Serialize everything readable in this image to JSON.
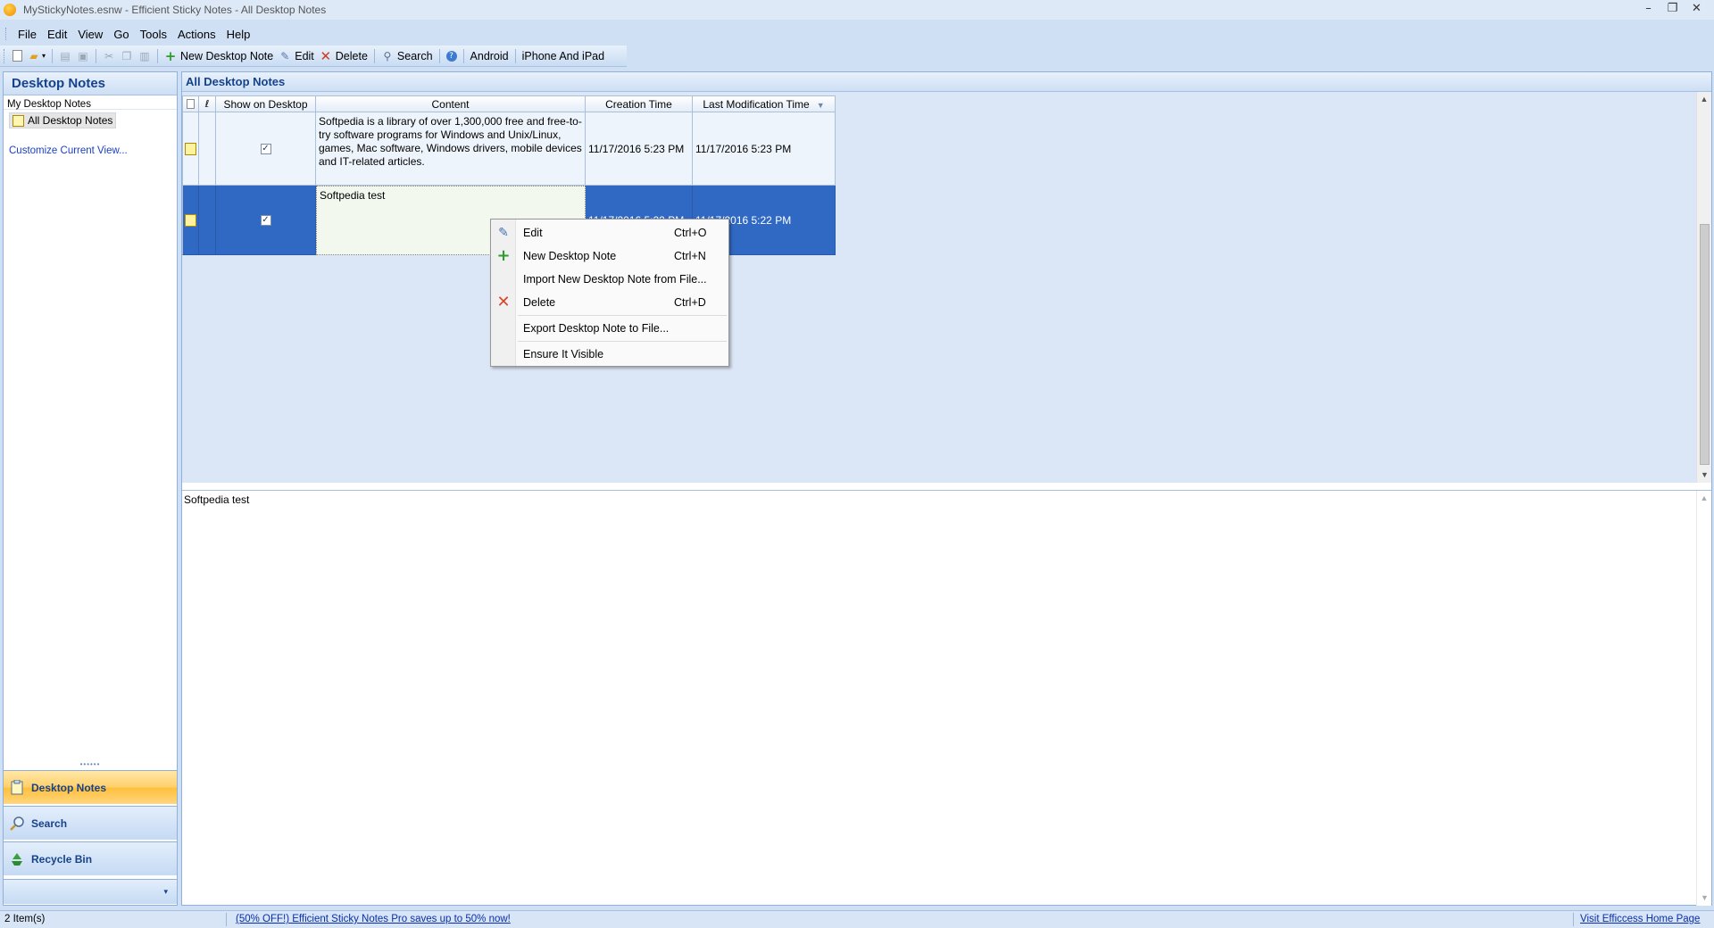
{
  "window": {
    "title": "MyStickyNotes.esnw - Efficient Sticky Notes - All Desktop Notes",
    "controls": [
      "–",
      "❐",
      "✕"
    ]
  },
  "menubar": {
    "items": [
      "File",
      "Edit",
      "View",
      "Go",
      "Tools",
      "Actions",
      "Help"
    ]
  },
  "toolbar": {
    "new_label": "New Desktop Note",
    "edit_label": "Edit",
    "delete_label": "Delete",
    "search_label": "Search",
    "android_label": "Android",
    "iphone_label": "iPhone And iPad"
  },
  "sidebar": {
    "header": "Desktop Notes",
    "section": "My Desktop Notes",
    "tree_item": "All Desktop Notes",
    "customize": "Customize Current View...",
    "nav": [
      {
        "label": "Desktop Notes",
        "icon": "sticky-note-icon",
        "active": true
      },
      {
        "label": "Search",
        "icon": "magnifier-icon",
        "active": false
      },
      {
        "label": "Recycle Bin",
        "icon": "recycle-bin-icon",
        "active": false
      }
    ],
    "footer_glyph": "▾"
  },
  "main": {
    "header": "All Desktop Notes",
    "columns": [
      "",
      "",
      "Show on Desktop",
      "Content",
      "Creation Time",
      "Last Modification Time"
    ],
    "rows": [
      {
        "show_on_desktop": true,
        "content": "Softpedia is a library of over 1,300,000 free and free-to-try software programs for Windows and Unix/Linux, games, Mac software, Windows drivers, mobile devices and IT-related articles.",
        "created": "11/17/2016 5:23 PM",
        "modified": "11/17/2016 5:23 PM",
        "selected": false
      },
      {
        "show_on_desktop": true,
        "content": "Softpedia test",
        "created": "11/17/2016 5:22 PM",
        "modified": "11/17/2016 5:22 PM",
        "selected": true
      }
    ],
    "preview_text": "Softpedia test"
  },
  "context_menu": {
    "items": [
      {
        "label": "Edit",
        "shortcut": "Ctrl+O",
        "icon": "pencil-icon"
      },
      {
        "label": "New Desktop Note",
        "shortcut": "Ctrl+N",
        "icon": "plus-icon"
      },
      {
        "label": "Import New Desktop Note from File...",
        "shortcut": "",
        "icon": ""
      },
      {
        "label": "Delete",
        "shortcut": "Ctrl+D",
        "icon": "delete-x-icon"
      },
      {
        "label": "Export Desktop Note to File...",
        "shortcut": "",
        "icon": ""
      },
      {
        "label": "Ensure It Visible",
        "shortcut": "",
        "icon": ""
      }
    ]
  },
  "statusbar": {
    "item_count": "2 Item(s)",
    "promo": "(50% OFF!) Efficient Sticky Notes Pro saves up to 50% now!",
    "home_link": "Visit Efficcess Home Page"
  },
  "colors": {
    "selection": "#3069c4",
    "header_text": "#15428b",
    "active_nav": "#ffd06a",
    "link": "#0a2fa8"
  }
}
